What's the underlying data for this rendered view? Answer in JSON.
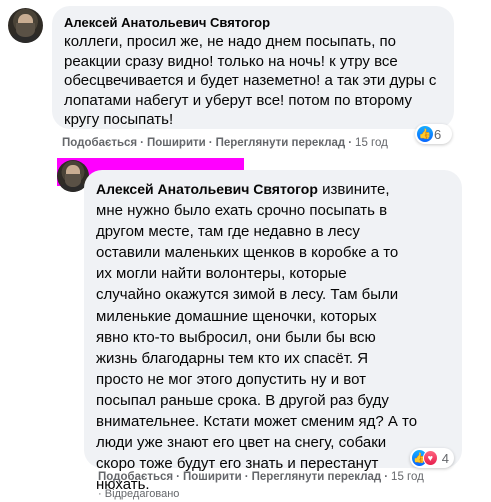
{
  "comments": [
    {
      "author": "Алексей Анатольевич Святогор",
      "text": "коллеги, просил же, не надо днем посыпать, по\nреакции сразу видно! только на ночь! к утру все\nобесцвечивается и будет наземетно! а так эти дуры с\nлопатами набегут и уберут все! потом по второму\nкругу посыпать!",
      "reaction_count": "6",
      "actions": {
        "like": "Подобається",
        "reply": "Поширити",
        "translate": "Переглянути переклад",
        "time": "15 год"
      }
    },
    {
      "author": "Алексей Анатольевич Святогор",
      "text_first": " извините,",
      "text_rest": "мне нужно было ехать срочно посыпать в\nдругом месте, там где недавно в лесу\nоставили маленьких щенков в коробке а то\nих могли найти волонтеры, которые\nслучайно окажутся зимой в лесу. Там были\nмиленькие домашние щеночки, которых\nявно кто-то выбросил, они были бы всю\nжизнь благодарны тем кто их спасёт. Я\nпросто не мог этого допустить ну и вот\nпосыпал раньше срока. В другой раз буду\nвнимательнее. Кстати может сменим яд? А то\nлюди уже знают его цвет на снегу, собаки\nскоро тоже будут его знать и перестанут\nнюхать.",
      "reaction_count": "4",
      "actions": {
        "like": "Подобається",
        "reply": "Поширити",
        "translate": "Переглянути переклад",
        "time": "15 год"
      },
      "edited": "Відредаговано"
    }
  ],
  "colors": {
    "bubble": "#f0f2f5",
    "meta": "#65676b",
    "redaction": "#ff00ff",
    "like": "#0866ff",
    "love": "#e61e4d"
  },
  "icons": [
    "like-icon",
    "heart-icon"
  ]
}
